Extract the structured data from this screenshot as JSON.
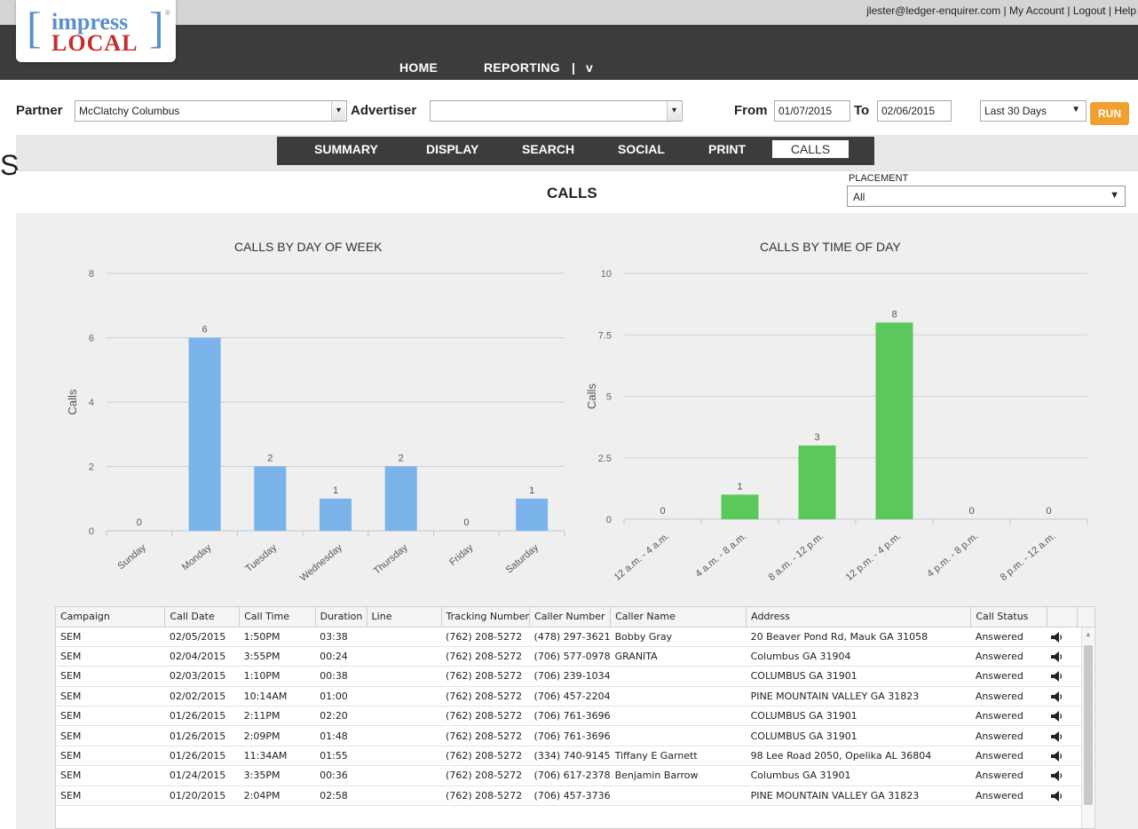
{
  "header": {
    "logo_top": "impress",
    "logo_bottom": "LOCAL",
    "logo_reg": "®",
    "user_email": "jlester@ledger-enquirer.com",
    "links": [
      "My Account",
      "Logout",
      "Help"
    ],
    "nav": {
      "home": "HOME",
      "reporting": "REPORTING",
      "separator": "|",
      "chevron": "v"
    }
  },
  "filters": {
    "partner_label": "Partner",
    "partner_value": "McClatchy Columbus",
    "advertiser_label": "Advertiser",
    "advertiser_value": "",
    "from_label": "From",
    "from_value": "01/07/2015",
    "to_label": "To",
    "to_value": "02/06/2015",
    "range_value": "Last 30 Days",
    "run_label": "RUN"
  },
  "tabs": [
    "SUMMARY",
    "DISPLAY",
    "SEARCH",
    "SOCIAL",
    "PRINT",
    "CALLS"
  ],
  "active_tab": "CALLS",
  "stray_text": "S",
  "calls": {
    "title": "CALLS",
    "placement_label": "PLACEMENT",
    "placement_value": "All"
  },
  "colors": {
    "accent": "#f0a030",
    "blue_bar": "#7ab4ea",
    "green_bar": "#5ac85a",
    "nav_bg": "#3c3c3c"
  },
  "chart_data": [
    {
      "type": "bar",
      "title": "CALLS BY DAY OF WEEK",
      "ylabel": "Calls",
      "xlabel": "",
      "categories": [
        "Sunday",
        "Monday",
        "Tuesday",
        "Wednesday",
        "Thursday",
        "Friday",
        "Saturday"
      ],
      "values": [
        0,
        6,
        2,
        1,
        2,
        0,
        1
      ],
      "ylim": [
        0,
        8
      ],
      "yticks": [
        0,
        2,
        4,
        6,
        8
      ],
      "color": "#7ab4ea",
      "grid": true
    },
    {
      "type": "bar",
      "title": "CALLS BY TIME OF DAY",
      "ylabel": "Calls",
      "xlabel": "",
      "categories": [
        "12 a.m. - 4 a.m.",
        "4 a.m. - 8 a.m.",
        "8 a.m. - 12 p.m.",
        "12 p.m. - 4 p.m.",
        "4 p.m. - 8 p.m.",
        "8 p.m. - 12 a.m."
      ],
      "values": [
        0,
        1,
        3,
        8,
        0,
        0
      ],
      "ylim": [
        0,
        10
      ],
      "yticks": [
        "0",
        "2.5",
        "5",
        "7.5",
        "10"
      ],
      "color": "#5ac85a",
      "grid": true
    }
  ],
  "table": {
    "columns": [
      "Campaign",
      "Call Date",
      "Call Time",
      "Duration",
      "Line",
      "Tracking Number",
      "Caller Number",
      "Caller Name",
      "Address",
      "Call Status",
      ""
    ],
    "rows": [
      [
        "SEM",
        "02/05/2015",
        "1:50PM",
        "03:38",
        "",
        "(762) 208-5272",
        "(478) 297-3621",
        "Bobby Gray",
        "20 Beaver Pond Rd, Mauk GA 31058",
        "Answered"
      ],
      [
        "SEM",
        "02/04/2015",
        "3:55PM",
        "00:24",
        "",
        "(762) 208-5272",
        "(706) 577-0978",
        "GRANITA",
        "Columbus GA 31904",
        "Answered"
      ],
      [
        "SEM",
        "02/03/2015",
        "1:10PM",
        "00:38",
        "",
        "(762) 208-5272",
        "(706) 239-1034",
        "",
        "COLUMBUS GA 31901",
        "Answered"
      ],
      [
        "SEM",
        "02/02/2015",
        "10:14AM",
        "01:00",
        "",
        "(762) 208-5272",
        "(706) 457-2204",
        "",
        "PINE MOUNTAIN VALLEY GA 31823",
        "Answered"
      ],
      [
        "SEM",
        "01/26/2015",
        "2:11PM",
        "02:20",
        "",
        "(762) 208-5272",
        "(706) 761-3696",
        "",
        "COLUMBUS GA 31901",
        "Answered"
      ],
      [
        "SEM",
        "01/26/2015",
        "2:09PM",
        "01:48",
        "",
        "(762) 208-5272",
        "(706) 761-3696",
        "",
        "COLUMBUS GA 31901",
        "Answered"
      ],
      [
        "SEM",
        "01/26/2015",
        "11:34AM",
        "01:55",
        "",
        "(762) 208-5272",
        "(334) 740-9145",
        "Tiffany E Garnett",
        "98 Lee Road 2050, Opelika AL 36804",
        "Answered"
      ],
      [
        "SEM",
        "01/24/2015",
        "3:35PM",
        "00:36",
        "",
        "(762) 208-5272",
        "(706) 617-2378",
        "Benjamin Barrow",
        "Columbus GA 31901",
        "Answered"
      ],
      [
        "SEM",
        "01/20/2015",
        "2:04PM",
        "02:58",
        "",
        "(762) 208-5272",
        "(706) 457-3736",
        "",
        "PINE MOUNTAIN VALLEY GA 31823",
        "Answered"
      ]
    ]
  }
}
